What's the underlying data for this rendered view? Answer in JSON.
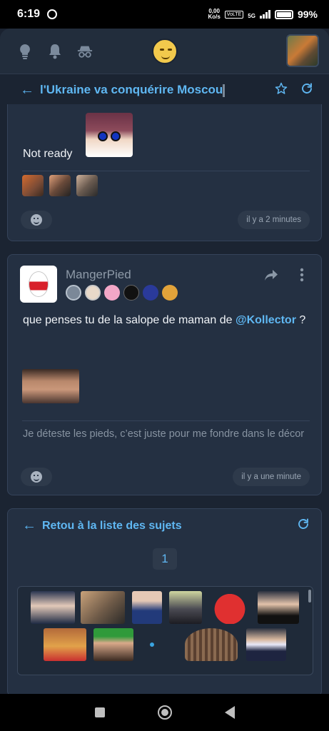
{
  "status_bar": {
    "time": "6:19",
    "net_speed": "0,00",
    "net_unit": "Ko/s",
    "volte": "VoLTE",
    "network": "5G",
    "battery_level": 0.99,
    "battery_text": "99%"
  },
  "topbar": {
    "icons": [
      "lightbulb-icon",
      "bell-icon",
      "incognito-icon"
    ]
  },
  "thread": {
    "title": "l'Ukraine va conquérire Moscou"
  },
  "post1": {
    "text": "Not ready",
    "reaction_count": 3,
    "time": "il y a 2 minutes"
  },
  "post2": {
    "username": "MangerPied",
    "badge_count": 6,
    "message_before": "que penses tu de la salope de maman de ",
    "mention": "@Kollector",
    "message_after": " ?",
    "signature": "Je déteste les pieds, c’est juste pour me fondre dans le décor",
    "time": "il y a une minute"
  },
  "footer_card": {
    "back_label": "Retou à la liste des sujets",
    "page": "1"
  },
  "colors": {
    "accent": "#5fb7f2",
    "background": "#1b2432",
    "card": "#243042"
  }
}
